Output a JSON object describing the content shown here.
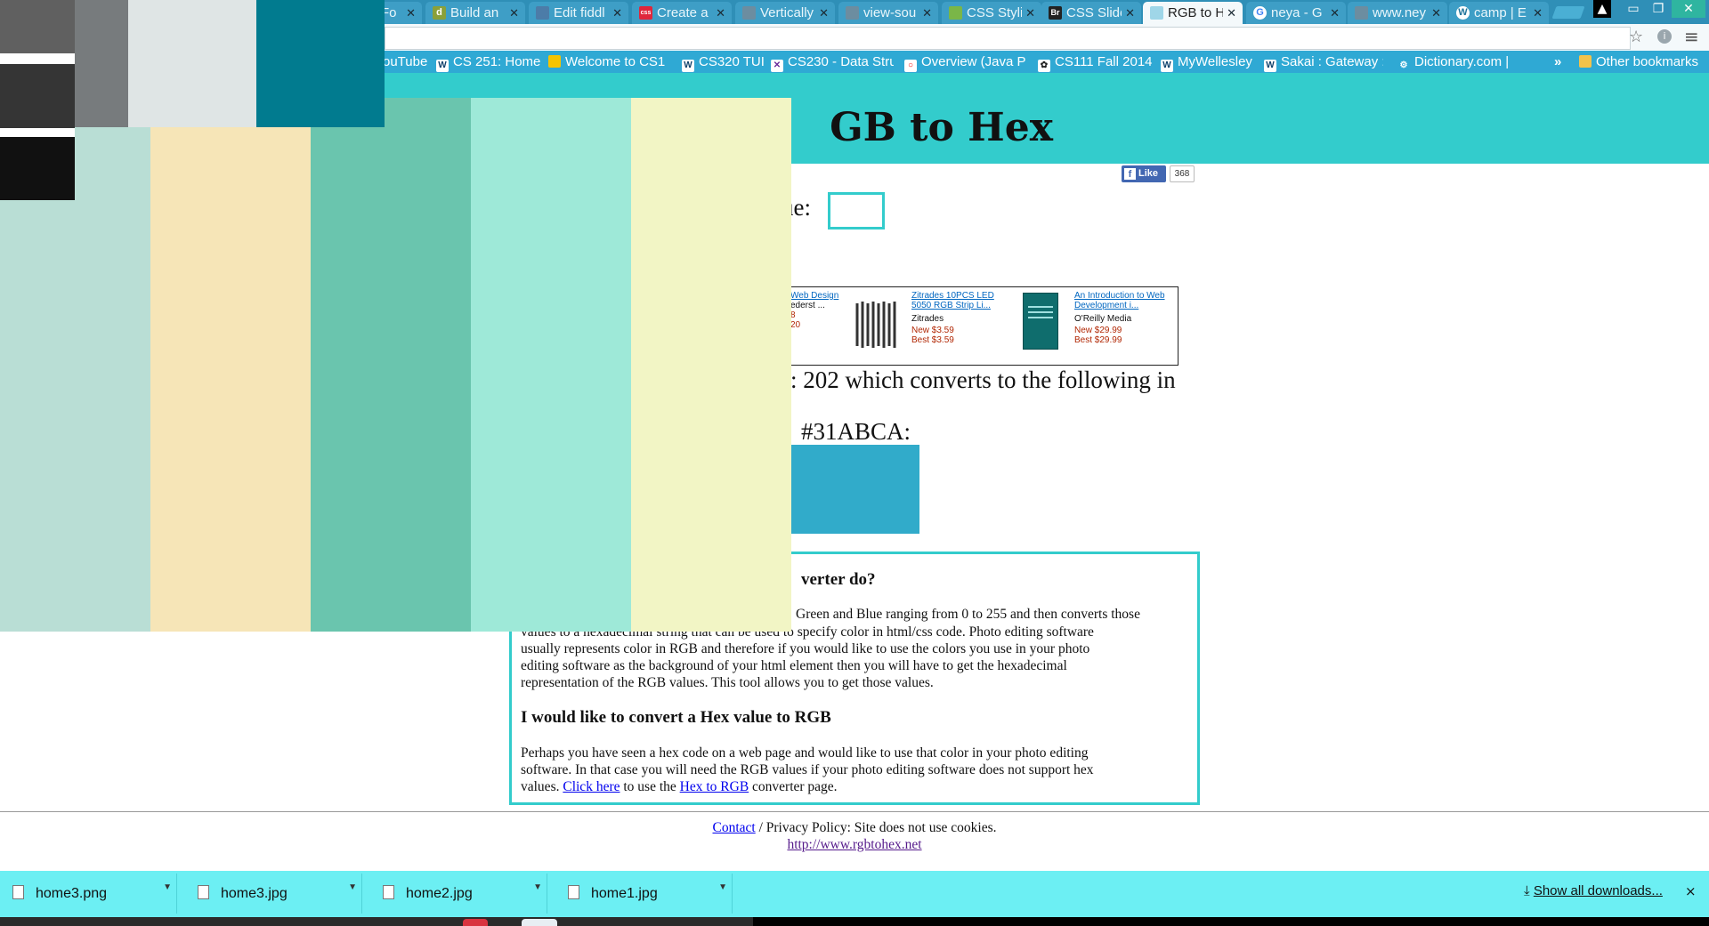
{
  "browser": {
    "tabs": [
      {
        "title": "Fo",
        "favicon": "doc"
      },
      {
        "title": "Build an",
        "favicon": "d"
      },
      {
        "title": "Edit fiddl",
        "favicon": "jsfiddle"
      },
      {
        "title": "Create a",
        "favicon": "css"
      },
      {
        "title": "Vertically",
        "favicon": "doc"
      },
      {
        "title": "view-sou",
        "favicon": "doc"
      },
      {
        "title": "CSS Stylin",
        "favicon": "css3"
      },
      {
        "title": "CSS Slide",
        "favicon": "Br"
      },
      {
        "title": "RGB to H",
        "favicon": "doc",
        "active": true
      },
      {
        "title": "neya - G",
        "favicon": "G"
      },
      {
        "title": "www.ney",
        "favicon": "doc"
      },
      {
        "title": "camp | E",
        "favicon": "W"
      }
    ],
    "bookmarks": [
      "ouTube",
      "CS 251: Home",
      "Welcome to CS1",
      "CS320 TUI",
      "CS230 - Data Stru",
      "Overview (Java Pl",
      "CS111 Fall 2014",
      "MyWellesley",
      "Sakai : Gateway :",
      "Dictionary.com | "
    ],
    "bookmarks_more": "»",
    "other_bookmarks": "Other bookmarks"
  },
  "page": {
    "title": "GB to Hex",
    "fb_like": "Like",
    "fb_count": "368",
    "value_label": "ue:",
    "ads": [
      {
        "title": "Web Design",
        "author": "ederst ...",
        "new_price": "8",
        "best_price": "20"
      },
      {
        "title": "Zitrades 10PCS LED 5050 RGB Strip Li...",
        "author": "Zitrades",
        "new_price": "New $3.59",
        "best_price": "Best $3.59"
      },
      {
        "title": "An Introduction to Web Development i...",
        "author": "O'Reilly Media",
        "new_price": "New $29.99",
        "best_price": "Best $29.99"
      }
    ],
    "result_line1": ": 202 which converts to the following in",
    "result_line2": "#31ABCA:",
    "result_color": "#31ABCA",
    "heading_partial": "verter do?",
    "para1_partial": "Green and Blue ranging from 0 to 255 and then converts those",
    "para1_lines": [
      "values to a hexadecimal string that can be used to specify color in html/css code. Photo editing software",
      "usually represents color in RGB and therefore if you would like to use the colors you use in your photo",
      "editing software as the background of your html element then you will have to get the hexadecimal",
      "representation of the RGB values. This tool allows you to get those values."
    ],
    "heading2": "I would like to convert a Hex value to RGB",
    "para2_lines": [
      "Perhaps you have seen a hex code on a web page and would like to use that color in your photo editing",
      "software. In that case you will need the RGB values if your photo editing software does not support hex"
    ],
    "para2_last_pre": "values.",
    "click_here": "Click here",
    "para2_mid": "to use the",
    "hex_to_rgb": "Hex to RGB",
    "para2_end": "converter page.",
    "footer_contact": "Contact",
    "footer_policy": "/ Privacy Policy: Site does not use cookies.",
    "footer_url": "http://www.rgbtohex.net"
  },
  "overlay": {
    "greys": [
      "#606060",
      "#353535",
      "#111111"
    ],
    "top": [
      "#777b7d",
      "#dfe5e5",
      "#017b8f"
    ],
    "stripes": [
      "#b9ded5",
      "#f6e5b7",
      "#6ac5ae",
      "#9ee9d8",
      "#f2f5c5"
    ]
  },
  "downloads": {
    "items": [
      "home3.png",
      "home3.jpg",
      "home2.jpg",
      "home1.jpg"
    ],
    "show_all": "Show all downloads...",
    "close": "×"
  },
  "colors": {
    "tabstrip": "#2f8fb7",
    "bookmarks": "#2fa9d4",
    "header": "#33cccc",
    "downloads": "#6ceff3"
  }
}
